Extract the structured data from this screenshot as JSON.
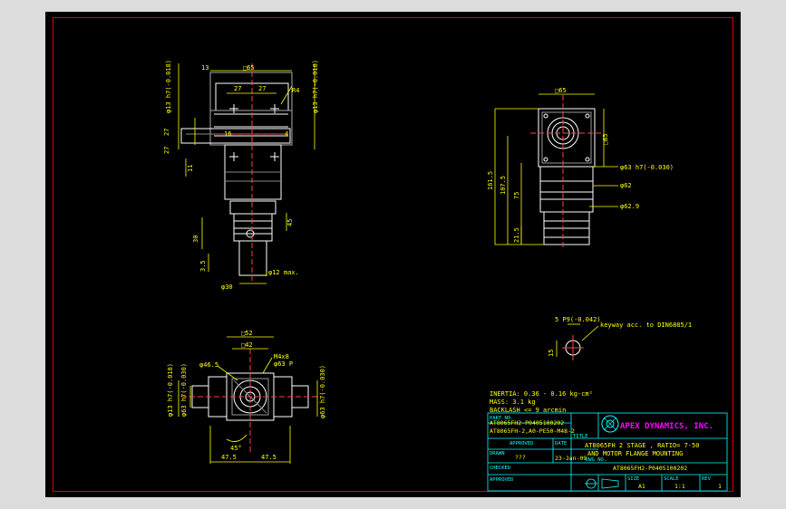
{
  "colors": {
    "background": "#dcdcdc",
    "canvas": "#000000",
    "frame": "#e00000",
    "dim": "#ffff00",
    "geometry": "#ffffff",
    "titleblock": "#00ffff",
    "logo": "#ff00ff"
  },
  "front_view": {
    "d_top": "□65",
    "d_sq_left": "13",
    "d_27a": "27",
    "d_27b": "27",
    "d_4": "4",
    "d_l27a": "27",
    "d_l27b": "27",
    "d_l11": "11",
    "d_30": "30",
    "d_dia13a": "φ13 h7(-0.018)",
    "d_dia13b": "φ13 h7(-0.018)",
    "d_45": "45",
    "d_35": "3.5",
    "d_12": "φ12 max.",
    "d_dia30": "φ30",
    "d_r1": "R4",
    "d_r2": "16"
  },
  "side_view": {
    "d_top": "□65",
    "d_right": "□65",
    "d_h1": "161.5",
    "d_h2": "107.5",
    "d_h3": "75",
    "d_h4": "21.5",
    "d_dia63": "φ63 h7(-0.030)",
    "d_dia62": "φ62",
    "d_dia629": "φ62.9"
  },
  "bottom_view": {
    "d_52": "□52",
    "d_42": "□42",
    "d_m4": "M4x8",
    "d_dia63p": "φ63 P",
    "d_dia40": "φ40",
    "d_dia462": "φ46.5",
    "d_left": "φ13 h7(-0.018)",
    "d_left2": "φ63 h7(-0.030)",
    "d_right": "φ63 h7(-0.030)",
    "d_angle": "45°",
    "d_475a": "47.5",
    "d_475b": "47.5"
  },
  "keyway": {
    "d_5p9": "5 P9(-0.042)",
    "note": "keyway acc. to DIN6885/1",
    "d_15": "15"
  },
  "specs": {
    "inertia": "INERTIA: 0.36 - 0.16 kg-cm²",
    "mass": "MASS: 3.1 kg",
    "backlash": "BACKLASH <= 9 arcmin",
    "partno_label": "PART NO.",
    "partno1": "AT8065FH2-P0405100202",
    "partno2": "AT8065FH-2,A0-PE50-M48-2"
  },
  "titleblock": {
    "company": "APEX DYNAMICS, INC.",
    "title_label": "TITLE",
    "title1": "AT8065FH 2 STAGE , RATIO= 7-50",
    "title2": "AND MOTOR FLANGE MOUNTING",
    "approved_label": "APPROVED",
    "date_label": "DATE",
    "drawn_label": "DRAWN",
    "drawn_value": "???",
    "date_value": "23-Jan-09",
    "dwg_label": "DWG NO.",
    "dwg_value": "AT8065FH2-P0405100202",
    "checked_label": "CHECKED",
    "approved2_label": "APPROVED",
    "size_label": "SIZE",
    "size_value": "A1",
    "scale_label": "SCALE",
    "scale_value": "1:1",
    "rev_label": "REV",
    "rev_value": "1"
  }
}
